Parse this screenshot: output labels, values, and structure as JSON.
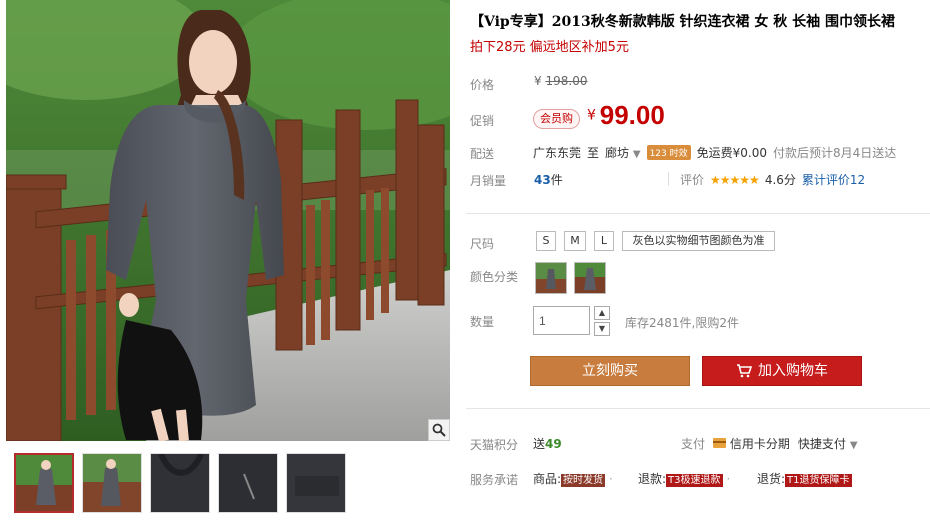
{
  "product": {
    "title": "【Vip专享】2013秋冬新款韩版 针织连衣裙 女 秋 长袖 围巾领长裙",
    "subtitle": "拍下28元 偏远地区补加5元"
  },
  "price": {
    "label": "价格",
    "currency": "¥",
    "original": "198.00",
    "promo_label": "促销",
    "member_badge": "会员购",
    "promo_price": "99.00"
  },
  "shipping": {
    "label": "配送",
    "from": "广东东莞",
    "to_word": "至",
    "to": "廊坊",
    "time_tag": "123 时效",
    "free": "免运费¥0.00",
    "eta": "付款后预计8月4日送达"
  },
  "sales": {
    "label": "月销量",
    "count": "43",
    "unit": "件",
    "rating_label": "评价",
    "stars": "★★★★★",
    "score": "4.6分",
    "reviews": "累计评价12"
  },
  "size": {
    "label": "尺码",
    "options": [
      "S",
      "M",
      "L",
      "灰色以实物细节图颜色为准"
    ]
  },
  "color": {
    "label": "颜色分类"
  },
  "quantity": {
    "label": "数量",
    "value": "1",
    "up": "▲",
    "down": "▼",
    "stock": "库存2481件,限购2件"
  },
  "actions": {
    "buy_now": "立刻购买",
    "add_cart": "加入购物车"
  },
  "points": {
    "label": "天猫积分",
    "prefix": "送",
    "value": "49"
  },
  "payment": {
    "label": "支付",
    "card": "信用卡分期",
    "quick": "快捷支付"
  },
  "service": {
    "label": "服务承诺",
    "goods_prefix": "商品:",
    "goods_tag": "按时发货",
    "refund_prefix": "退款:",
    "refund_tag": "T3极速退款",
    "return_prefix": "退货:",
    "return_tag": "T1退货保障卡"
  },
  "colors": {
    "accent_red": "#c40000",
    "buy_now_bg": "#c87d3f",
    "add_cart_bg": "#c61c1c",
    "link_blue": "#1a5fa8"
  }
}
